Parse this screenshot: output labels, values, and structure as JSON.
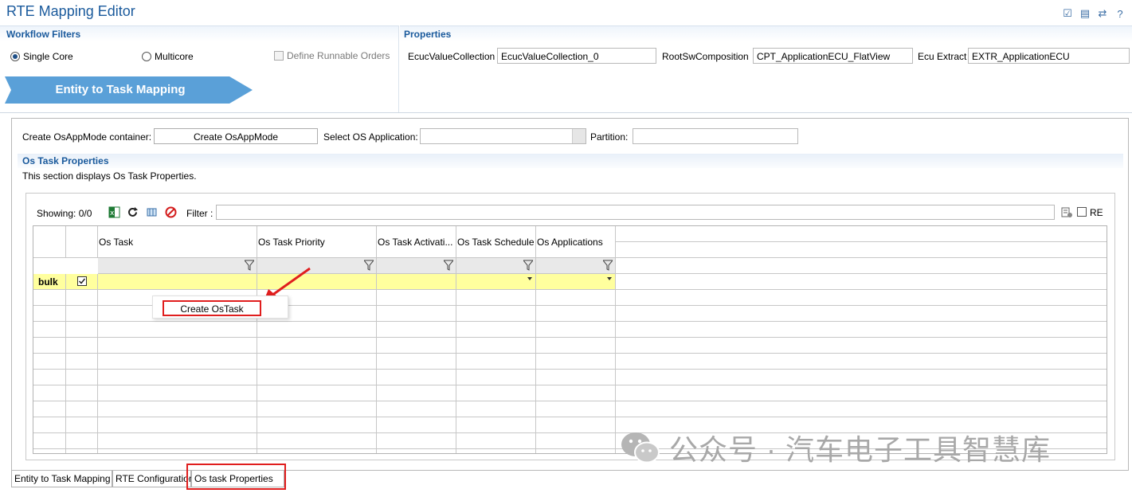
{
  "window": {
    "title": "RTE Mapping Editor"
  },
  "workflow_filters": {
    "header": "Workflow Filters",
    "single_core": "Single Core",
    "multicore": "Multicore",
    "define_runnable_orders": "Define Runnable Orders",
    "selected": "Single Core"
  },
  "properties": {
    "header": "Properties",
    "ecuc_value_collection_label": "EcucValueCollection",
    "ecuc_value_collection_value": "EcucValueCollection_0",
    "root_sw_composition_label": "RootSwComposition",
    "root_sw_composition_value": "CPT_ApplicationECU_FlatView",
    "ecu_extract_label": "Ecu Extract",
    "ecu_extract_value": "EXTR_ApplicationECU"
  },
  "banner": {
    "label": "Entity to Task Mapping"
  },
  "top_row": {
    "create_osappmode_label": "Create OsAppMode container:",
    "create_osappmode_button": "Create OsAppMode",
    "select_os_application_label": "Select OS Application:",
    "partition_label": "Partition:"
  },
  "os_task_properties": {
    "header": "Os Task Properties",
    "description": "This section displays Os Task Properties."
  },
  "table_toolbar": {
    "showing": "Showing: 0/0",
    "filter_label": "Filter :",
    "re_label": "RE"
  },
  "table": {
    "columns": [
      "Os Task",
      "Os Task Priority",
      "Os Task Activati...",
      "Os Task Schedule",
      "Os Applications"
    ],
    "bulk_label": "bulk"
  },
  "context_menu": {
    "item": "Create OsTask"
  },
  "tabs": [
    "Entity to Task Mapping",
    "RTE Configuration",
    "Os task Properties"
  ],
  "watermark": {
    "text": "公众号 · 汽车电子工具智慧库"
  },
  "colors": {
    "accent": "#1a5a9c",
    "banner": "#5aa0d8",
    "highlight": "#e01e1e",
    "bulk_row": "#ffff9e"
  }
}
